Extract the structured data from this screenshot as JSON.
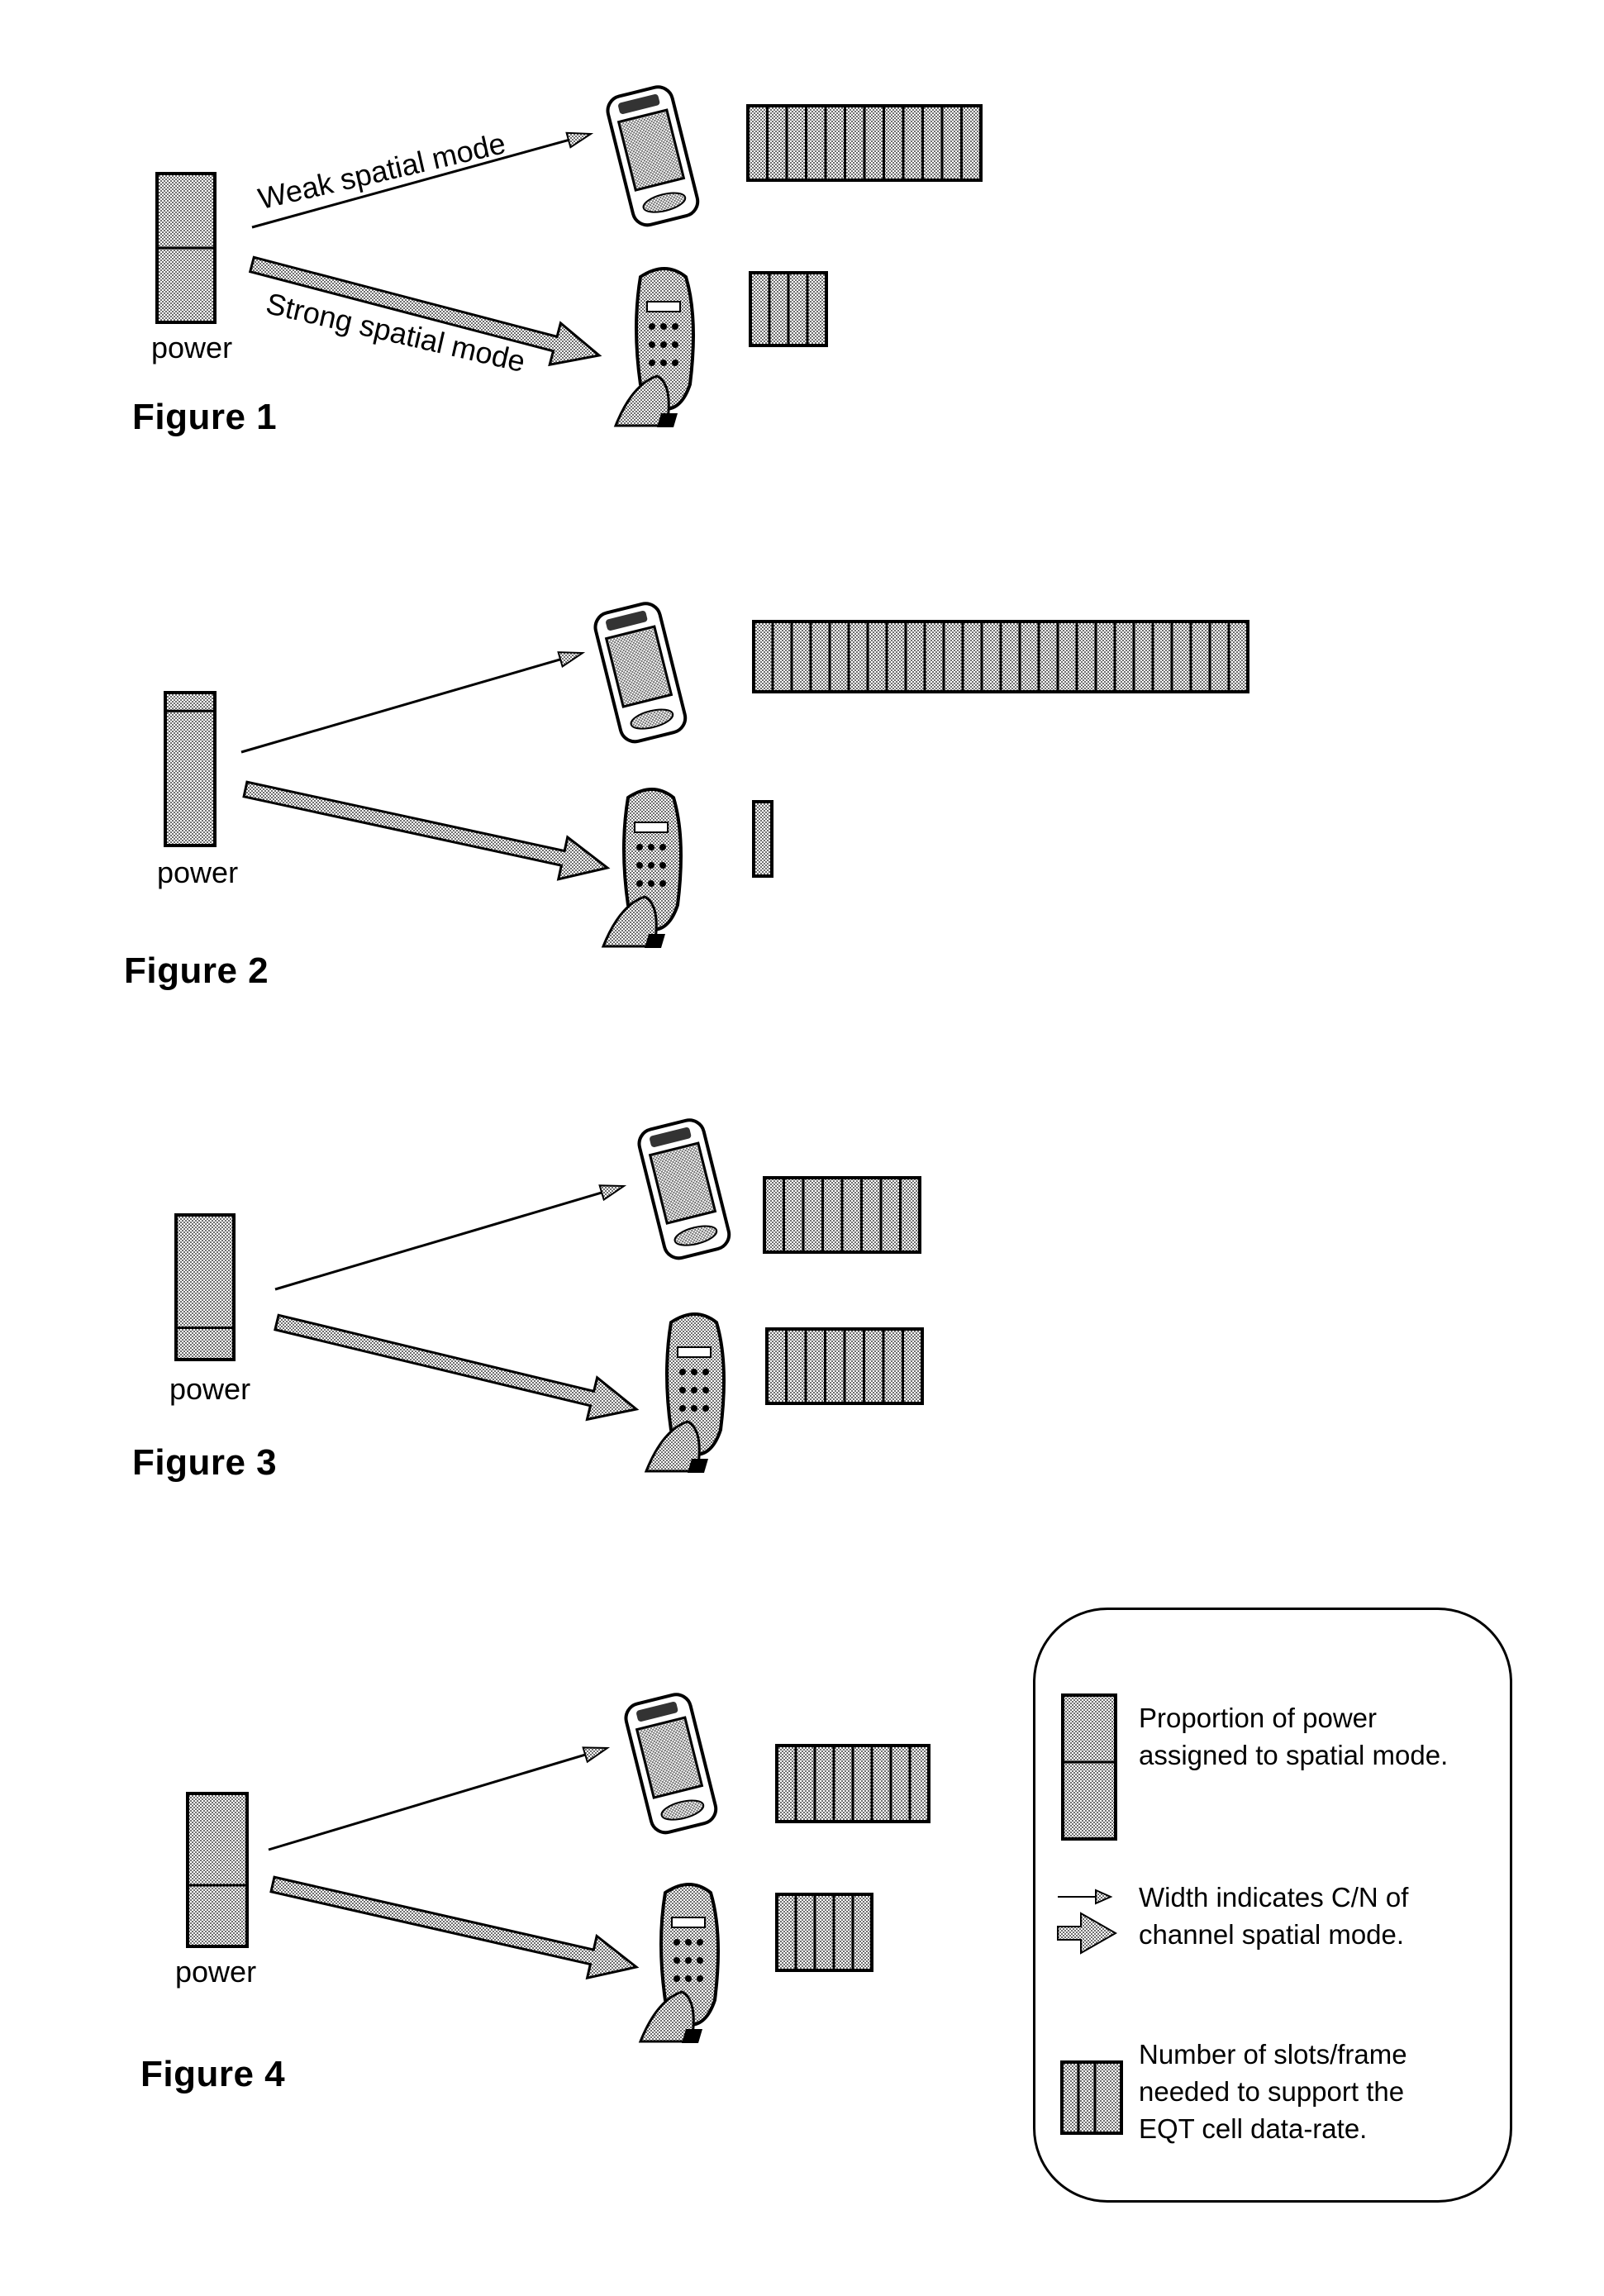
{
  "figures": [
    {
      "caption": "Figure 1",
      "power_label": "power",
      "power_split": {
        "top": 0.5,
        "bottom": 0.5
      },
      "weak_mode": {
        "label": "Weak spatial mode",
        "arrow": "thin",
        "device": "pda-icon",
        "slots": 12
      },
      "strong_mode": {
        "label": "Strong spatial mode",
        "arrow": "thick",
        "device": "phone-in-hand-icon",
        "slots": 4
      }
    },
    {
      "caption": "Figure 2",
      "power_label": "power",
      "power_split": {
        "top": 0.12,
        "bottom": 0.88
      },
      "weak_mode": {
        "label": "",
        "arrow": "thin",
        "device": "pda-icon",
        "slots": 26
      },
      "strong_mode": {
        "label": "",
        "arrow": "thick",
        "device": "phone-in-hand-icon",
        "slots": 1
      }
    },
    {
      "caption": "Figure 3",
      "power_label": "power",
      "power_split": {
        "top": 0.78,
        "bottom": 0.22
      },
      "weak_mode": {
        "label": "",
        "arrow": "thin",
        "device": "pda-icon",
        "slots": 8
      },
      "strong_mode": {
        "label": "",
        "arrow": "thick",
        "device": "phone-in-hand-icon",
        "slots": 8
      }
    },
    {
      "caption": "Figure 4",
      "power_label": "power",
      "power_split": {
        "top": 0.6,
        "bottom": 0.4
      },
      "weak_mode": {
        "label": "",
        "arrow": "thin",
        "device": "pda-icon",
        "slots": 8
      },
      "strong_mode": {
        "label": "",
        "arrow": "thick",
        "device": "phone-in-hand-icon",
        "slots": 5
      }
    }
  ],
  "legend": {
    "items": [
      {
        "icon": "power-bar-icon",
        "text_lines": [
          "Proportion of power",
          "assigned to spatial mode."
        ]
      },
      {
        "icon": "arrow-width-icon",
        "text_lines": [
          "Width indicates C/N of",
          "channel spatial mode."
        ]
      },
      {
        "icon": "slots-frame-icon",
        "text_lines": [
          "Number of slots/frame",
          "needed to support the",
          "EQT cell data-rate."
        ]
      }
    ]
  },
  "colors": {
    "ink": "#000000",
    "fill": "#9a9a9a",
    "paper": "#ffffff"
  }
}
